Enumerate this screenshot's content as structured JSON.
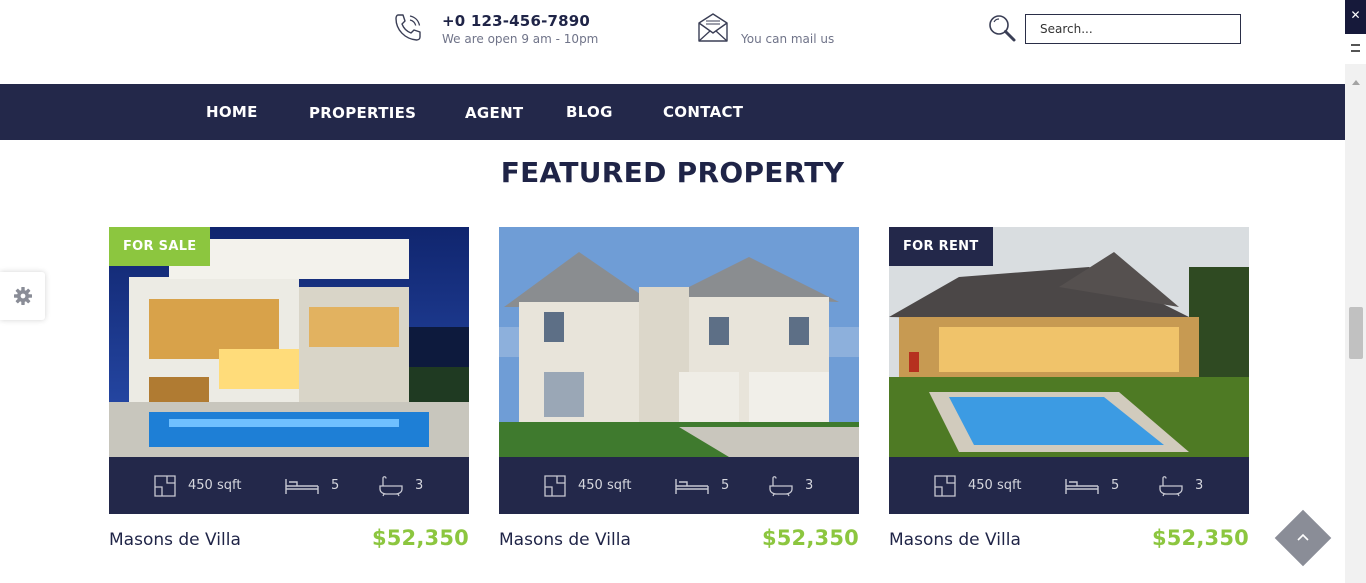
{
  "header": {
    "phone": "+0 123-456-7890",
    "hours": "We are open 9 am - 10pm",
    "mail_text": "You can mail us",
    "search_placeholder": "Search..."
  },
  "nav": {
    "items": [
      {
        "label": "HOME"
      },
      {
        "label": "PROPERTIES"
      },
      {
        "label": "AGENT"
      },
      {
        "label": "BLOG"
      },
      {
        "label": "CONTACT"
      }
    ]
  },
  "section": {
    "title": "FEATURED PROPERTY"
  },
  "properties": [
    {
      "badge": "FOR SALE",
      "badge_color": "#8cc63f",
      "area": "450 sqft",
      "beds": "5",
      "baths": "3",
      "name": "Masons de Villa",
      "price": "$52,350"
    },
    {
      "badge": "",
      "badge_color": "",
      "area": "450 sqft",
      "beds": "5",
      "baths": "3",
      "name": "Masons de Villa",
      "price": "$52,350"
    },
    {
      "badge": "FOR RENT",
      "badge_color": "#23284a",
      "area": "450 sqft",
      "beds": "5",
      "baths": "3",
      "name": "Masons de Villa",
      "price": "$52,350"
    }
  ],
  "colors": {
    "navy": "#23284a",
    "accent_green": "#8cc63f",
    "title_dark": "#1f2447"
  },
  "icons": {
    "phone": "phone-icon",
    "mail": "envelope-icon",
    "search": "search-icon",
    "settings": "gear-icon",
    "area": "floorplan-icon",
    "beds": "bed-icon",
    "baths": "bathtub-icon",
    "back_to_top": "chevron-up-icon"
  }
}
